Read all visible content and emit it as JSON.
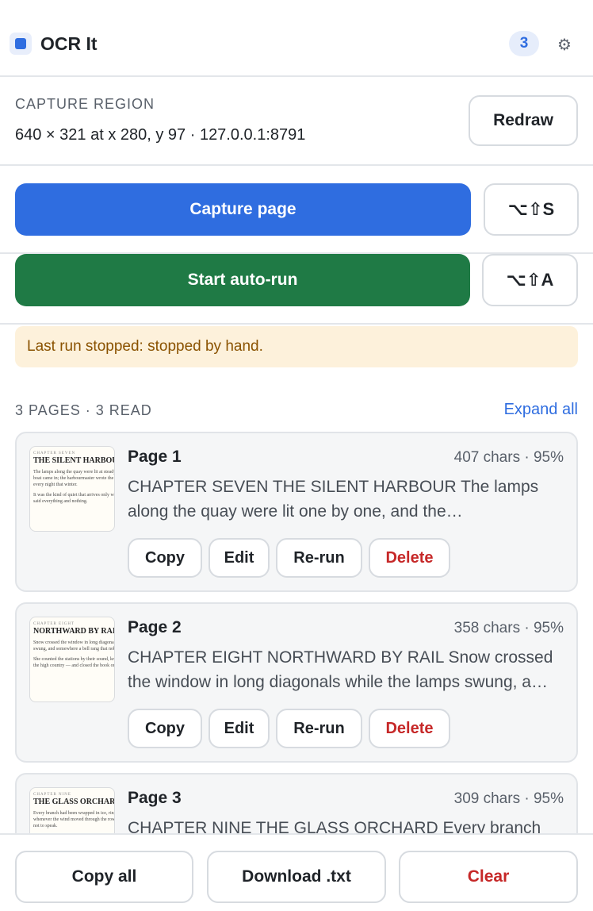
{
  "header": {
    "title": "OCR It",
    "badge_count": "3",
    "icons": {
      "app": "app-square-icon",
      "settings": "gear-icon"
    }
  },
  "region": {
    "label": "CAPTURE REGION",
    "value": "640 × 321 at x 280, y 97 · 127.0.0.1:8791",
    "redraw_label": "Redraw"
  },
  "actions": {
    "capture_label": "Capture page",
    "capture_shortcut": "⌥⇧S",
    "autorun_label": "Start auto-run",
    "autorun_shortcut": "⌥⇧A"
  },
  "notice": {
    "text": "Last run stopped: stopped by hand."
  },
  "pages": {
    "summary": "3 PAGES · 3 READ",
    "expand_label": "Expand all",
    "button_labels": {
      "copy": "Copy",
      "edit": "Edit",
      "rerun": "Re-run",
      "delete": "Delete"
    },
    "items": [
      {
        "title": "Page 1",
        "meta": "407 chars · 95%",
        "text": "CHAPTER SEVEN THE SILENT HARBOUR The lamps along the quay were lit one by one, and the harbourmaster wrote the same three words every night that winter.",
        "thumb_kicker": "CHAPTER SEVEN",
        "thumb_title": "THE SILENT HARBOUR",
        "thumb_para1": "The lamps along the quay were lit at steady until morning. No boat came in; the harbourmaster wrote the same three words every night that winter.",
        "thumb_para2": "It was the kind of quiet that arrives only when all parties have said everything and nothing."
      },
      {
        "title": "Page 2",
        "meta": "358 chars · 95%",
        "text": "CHAPTER EIGHT NORTHWARD BY RAIL Snow crossed the window in long diagonals while the lamps swung, and somewhere a bell rang that nobody answered.",
        "thumb_kicker": "CHAPTER EIGHT",
        "thumb_title": "NORTHWARD BY RAIL",
        "thumb_para1": "Snow crossed the window in long diagonals while the lamps swung, and somewhere a bell rang that nobody answered.",
        "thumb_para2": "She counted the stations by their sound, knowing nothing of the high country — and closed the book on her lap."
      },
      {
        "title": "Page 3",
        "meta": "309 chars · 95%",
        "text": "CHAPTER NINE THE GLASS ORCHARD Every branch had been wrapped in ice, ringing faintly whenever the wind moved through the rows.",
        "thumb_kicker": "CHAPTER NINE",
        "thumb_title": "THE GLASS ORCHARD",
        "thumb_para1": "Every branch had been wrapped in ice, ringing faintly whenever the wind moved through the rows, people deciding not to speak.",
        "thumb_para2": ""
      }
    ]
  },
  "footer": {
    "copy_all_label": "Copy all",
    "download_label": "Download .txt",
    "clear_label": "Clear"
  },
  "colors": {
    "accent": "#2f6de0",
    "autorun": "#1f7a45",
    "danger": "#c62828",
    "notice_bg": "#fdf1db",
    "notice_text": "#8a5200"
  }
}
